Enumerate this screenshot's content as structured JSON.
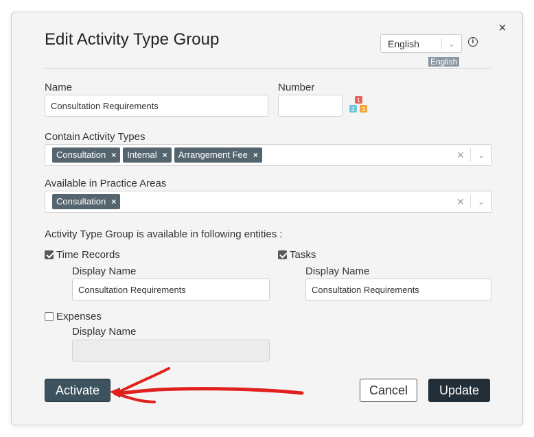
{
  "dialog": {
    "title": "Edit Activity Type Group",
    "language_select": "English",
    "language_badge": "English"
  },
  "form": {
    "name_label": "Name",
    "name_value": "Consultation Requirements",
    "number_label": "Number",
    "number_value": "",
    "contain_label": "Contain Activity Types",
    "contain_tags": [
      "Consultation",
      "Internal",
      "Arrangement Fee"
    ],
    "practice_label": "Available in Practice Areas",
    "practice_tags": [
      "Consultation"
    ],
    "entities_label": "Activity Type Group is available in following entities :",
    "time_records": {
      "label": "Time Records",
      "checked": true,
      "display_label": "Display Name",
      "display_value": "Consultation Requirements"
    },
    "tasks": {
      "label": "Tasks",
      "checked": true,
      "display_label": "Display Name",
      "display_value": "Consultation Requirements"
    },
    "expenses": {
      "label": "Expenses",
      "checked": false,
      "display_label": "Display Name",
      "display_value": ""
    }
  },
  "buttons": {
    "activate": "Activate",
    "cancel": "Cancel",
    "update": "Update"
  },
  "icons": {
    "close": "close-icon",
    "info": "info-icon",
    "numbering": "numbering-blocks-icon",
    "tag_remove": "×",
    "clear": "×",
    "chevron": "chevron-down-icon"
  },
  "colors": {
    "tag_bg": "#55656f",
    "activate_bg": "#3c525f",
    "update_bg": "#232f38",
    "annotation_arrow": "#e0201c"
  }
}
